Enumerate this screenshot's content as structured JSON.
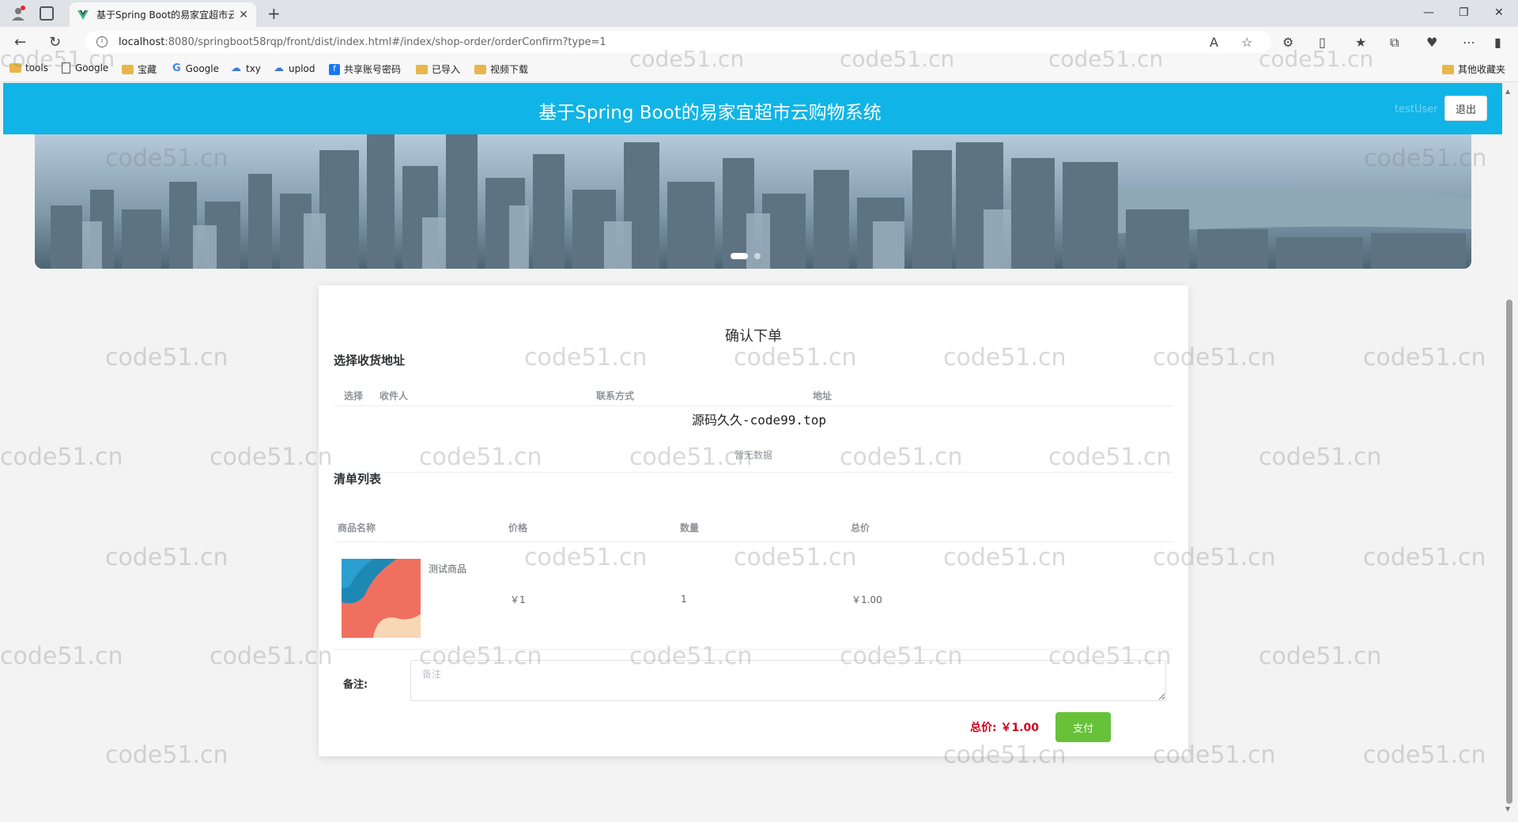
{
  "browser": {
    "tab_title": "基于Spring Boot的易家宜超市云",
    "url_host": "localhost",
    "url_rest": ":8080/springboot58rqp/front/dist/index.html#/index/shop-order/orderConfirm?type=1",
    "bookmarks": [
      "tools",
      "Google",
      "宝藏",
      "Google",
      "txy",
      "uplod",
      "共享账号密码",
      "已导入",
      "视频下载"
    ],
    "other_bookmarks": "其他收藏夹"
  },
  "header": {
    "title": "基于Spring Boot的易家宜超市云购物系统",
    "username": "testUser",
    "logout": "退出"
  },
  "card": {
    "title": "确认下单",
    "address_section": "选择收货地址",
    "address_headers": [
      "选择",
      "收件人",
      "联系方式",
      "地址"
    ],
    "empty_text": "暂无数据",
    "list_section": "清单列表",
    "list_headers": [
      "商品名称",
      "价格",
      "数量",
      "总价"
    ],
    "items": [
      {
        "name": "测试商品",
        "price": "￥1",
        "qty": "1",
        "total": "￥1.00"
      }
    ],
    "remark_label": "备注:",
    "remark_placeholder": "备注",
    "total_label": "总价:",
    "total_value": "￥1.00",
    "pay": "支付"
  },
  "watermark_text": "code51.cn",
  "overlay_text": "源码久久-code99.top",
  "colors": {
    "header": "#11b4e6",
    "pay": "#67c23a",
    "total": "#d0021b"
  }
}
